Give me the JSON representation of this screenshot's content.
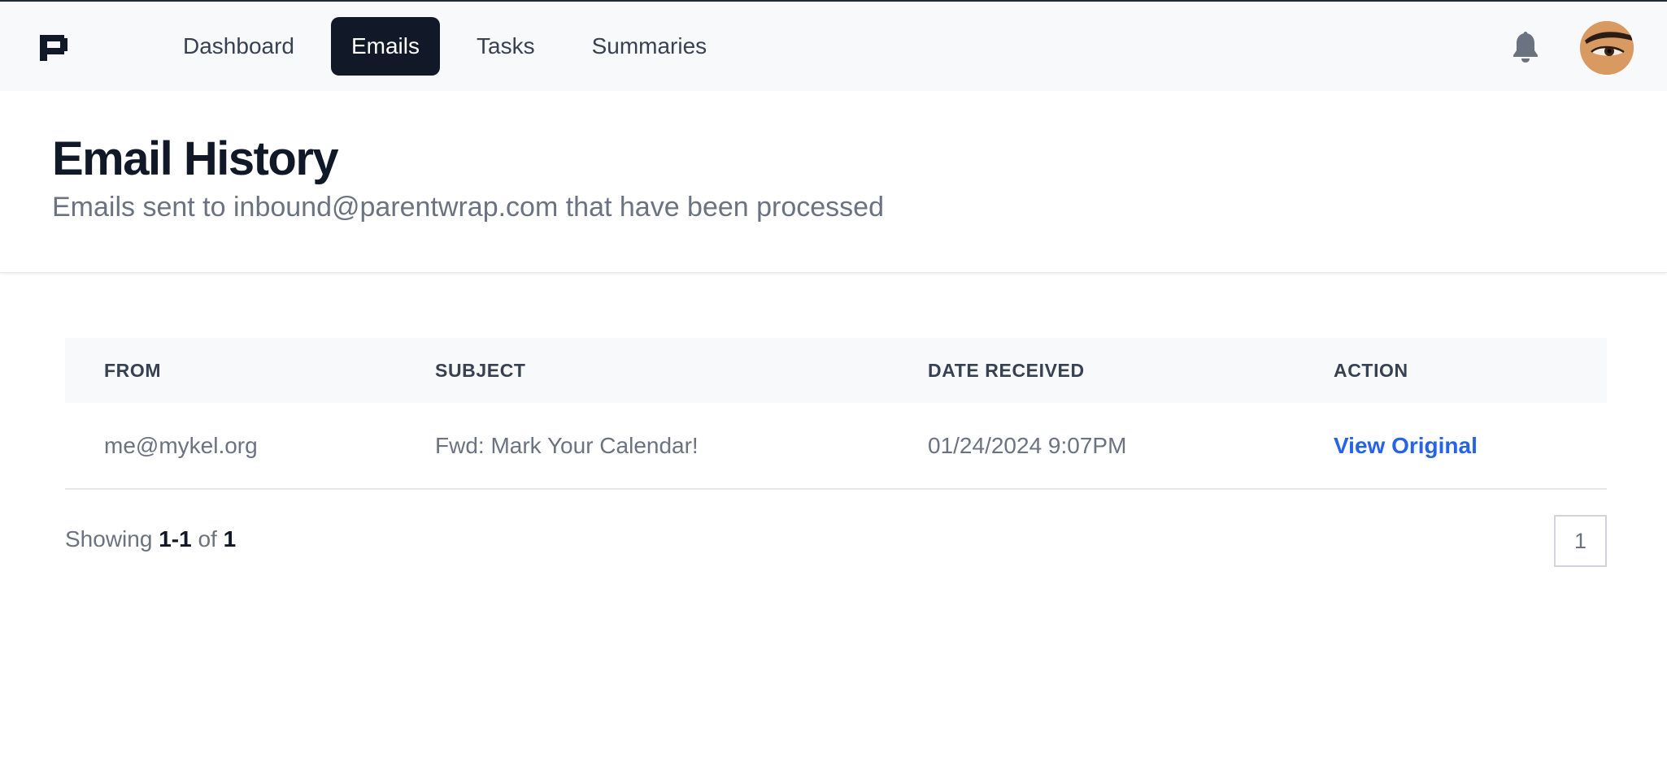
{
  "nav": {
    "items": [
      {
        "label": "Dashboard",
        "active": false
      },
      {
        "label": "Emails",
        "active": true
      },
      {
        "label": "Tasks",
        "active": false
      },
      {
        "label": "Summaries",
        "active": false
      }
    ],
    "icons": {
      "logo": "parentwrap-logo-icon",
      "notifications": "bell-icon",
      "user": "avatar"
    }
  },
  "header": {
    "title": "Email History",
    "subtitle": "Emails sent to inbound@parentwrap.com that have been processed"
  },
  "table": {
    "columns": [
      "FROM",
      "SUBJECT",
      "DATE RECEIVED",
      "ACTION"
    ],
    "rows": [
      {
        "from": "me@mykel.org",
        "subject": "Fwd: Mark Your Calendar!",
        "date": "01/24/2024 9:07PM",
        "action": "View Original"
      }
    ]
  },
  "pagination": {
    "showing_prefix": "Showing",
    "range": "1-1",
    "of_label": "of",
    "total": "1",
    "pages": [
      "1"
    ]
  },
  "colors": {
    "accent": "#111827",
    "link": "#2563eb",
    "muted_text": "#6b7280",
    "header_bg": "#f8f9fb"
  }
}
